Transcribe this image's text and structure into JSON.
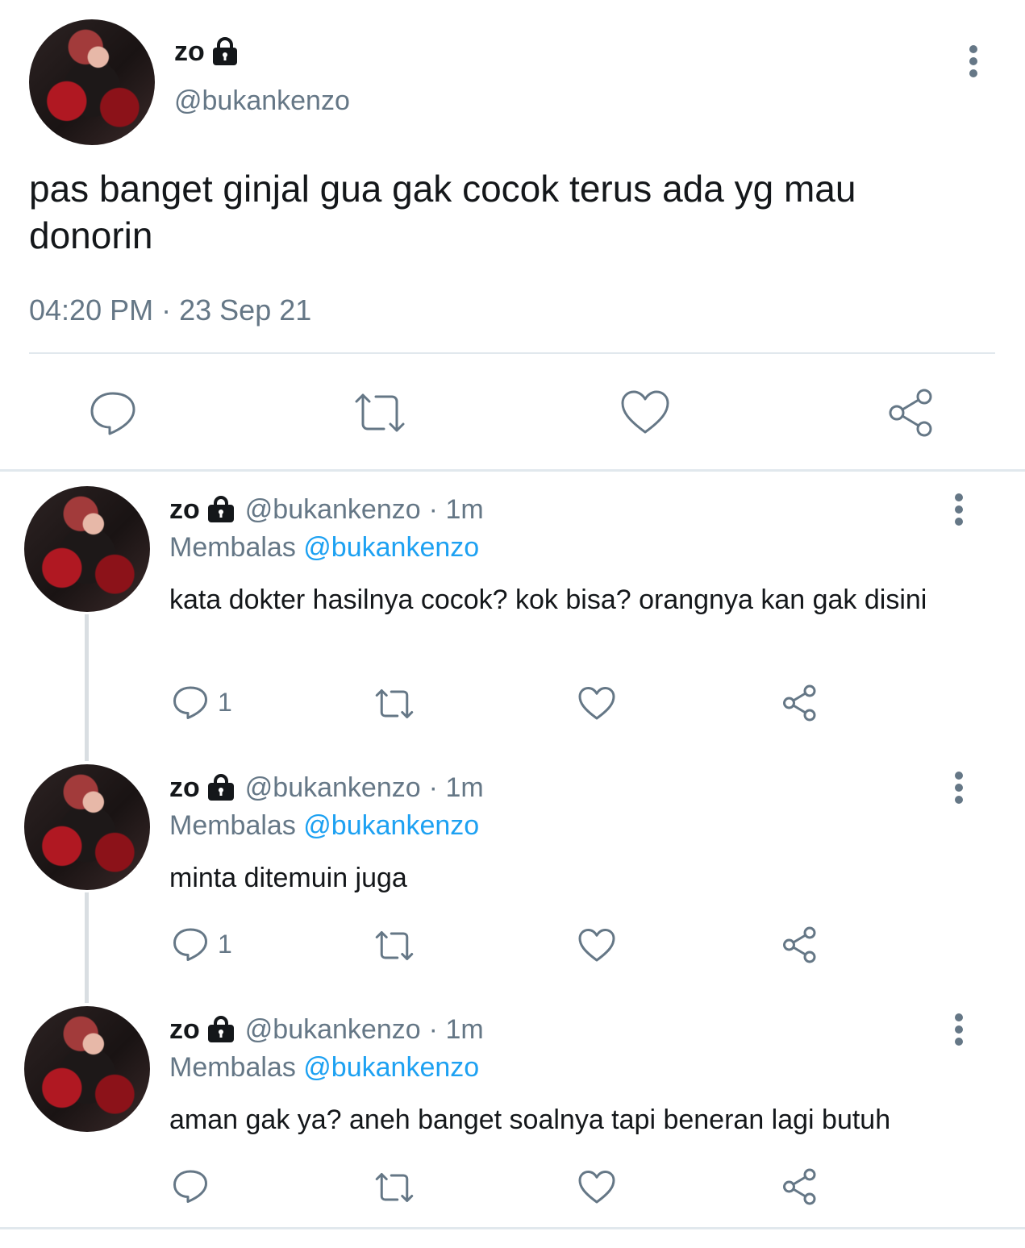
{
  "main": {
    "display_name": "zo",
    "handle": "@bukankenzo",
    "text": "pas banget ginjal gua gak cocok terus ada yg mau donorin",
    "time": "04:20 PM",
    "separator": "·",
    "date": "23 Sep 21"
  },
  "replies": [
    {
      "display_name": "zo",
      "handle": "@bukankenzo",
      "time_ago": "· 1m",
      "replying_label": "Membalas",
      "replying_to": "@bukankenzo",
      "text": "kata dokter hasilnya cocok? kok bisa? orangnya kan gak disini",
      "reply_count": "1"
    },
    {
      "display_name": "zo",
      "handle": "@bukankenzo",
      "time_ago": "· 1m",
      "replying_label": "Membalas",
      "replying_to": "@bukankenzo",
      "text": "minta ditemuin juga",
      "reply_count": "1"
    },
    {
      "display_name": "zo",
      "handle": "@bukankenzo",
      "time_ago": "· 1m",
      "replying_label": "Membalas",
      "replying_to": "@bukankenzo",
      "text": "aman gak ya? aneh banget soalnya tapi beneran lagi butuh",
      "reply_count": ""
    }
  ],
  "icons": {
    "reply": "reply-icon",
    "retweet": "retweet-icon",
    "like": "heart-icon",
    "share": "share-icon",
    "more": "more-vertical-icon",
    "lock": "lock-icon"
  },
  "colors": {
    "text": "#14171a",
    "secondary": "#657786",
    "accent": "#1da1f2",
    "divider": "#e1e8ed"
  }
}
